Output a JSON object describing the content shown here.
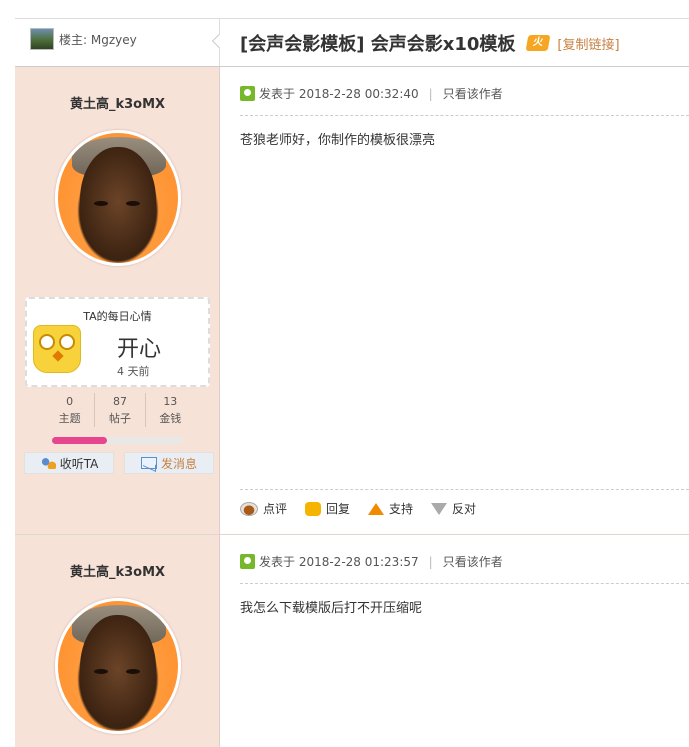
{
  "header": {
    "op_label": "楼主: Mgzyey",
    "title_category": "[会声会影模板]",
    "title_text": "会声会影x10模板",
    "hot_badge": "火",
    "copy_link": "[复制链接]"
  },
  "posts": [
    {
      "username": "黄土高_k3oMX",
      "mood": {
        "title": "TA的每日心情",
        "word": "开心",
        "time": "4 天前"
      },
      "stats": [
        {
          "value": "0",
          "label": "主题"
        },
        {
          "value": "87",
          "label": "帖子"
        },
        {
          "value": "13",
          "label": "金钱"
        }
      ],
      "progress_fraction": 0.42,
      "buttons": {
        "listen": "收听TA",
        "message": "发消息"
      },
      "meta": {
        "posted_at": "发表于 2018-2-28 00:32:40",
        "author_only": "只看该作者"
      },
      "content": "苍狼老师好，你制作的模板很漂亮",
      "actions": {
        "comment": "点评",
        "reply": "回复",
        "support": "支持",
        "oppose": "反对"
      }
    },
    {
      "username": "黄土高_k3oMX",
      "meta": {
        "posted_at": "发表于 2018-2-28 01:23:57",
        "author_only": "只看该作者"
      },
      "content": "我怎么下载模版后打不开压缩呢"
    }
  ],
  "colors": {
    "sidebar_bg": "#f7e2d8",
    "progress": "#e8458f",
    "link_orange": "#c78140"
  }
}
